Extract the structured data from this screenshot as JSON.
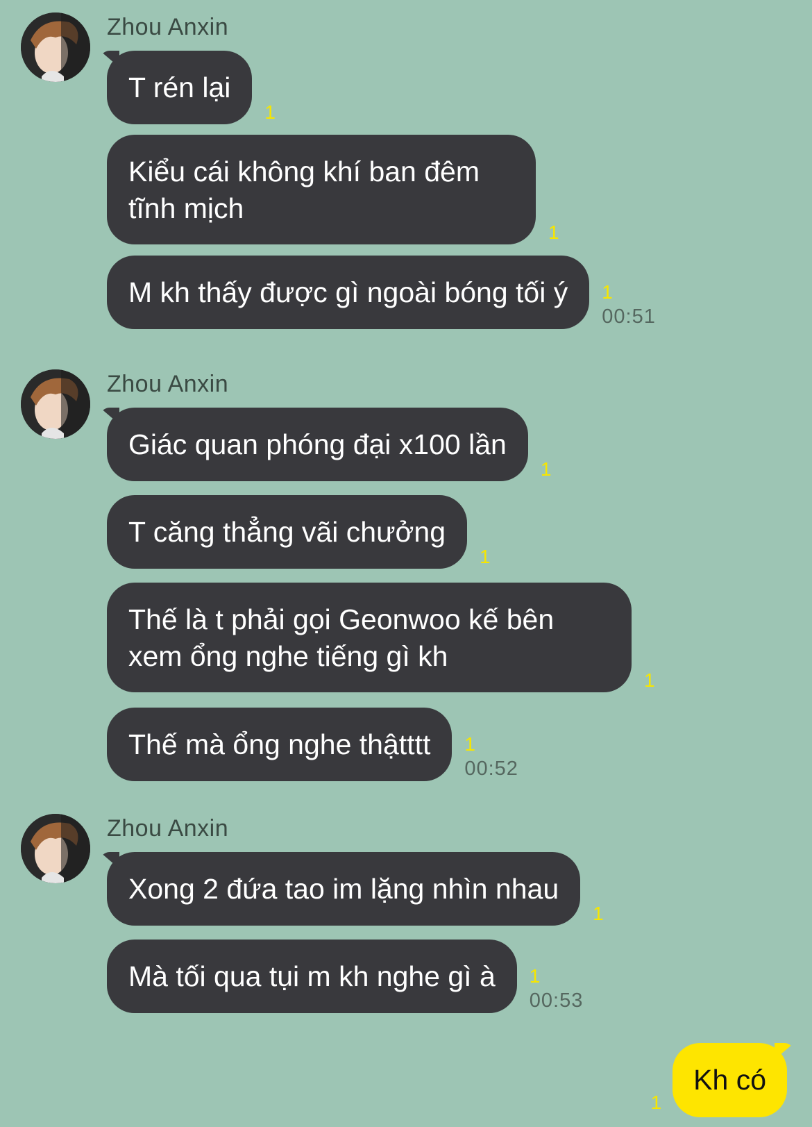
{
  "colors": {
    "background": "#9dc5b4",
    "incoming_bubble": "#39393d",
    "outgoing_bubble": "#fee500",
    "unread": "#f7e600"
  },
  "groups": [
    {
      "sender": "Zhou Anxin",
      "avatar_icon": "profile-photo",
      "messages": [
        {
          "text": "T rén lại",
          "unread": "1",
          "time": ""
        },
        {
          "text": "Kiểu cái không khí ban đêm tĩnh mịch",
          "unread": "1",
          "time": ""
        },
        {
          "text": "M kh thấy được gì ngoài bóng tối ý",
          "unread": "1",
          "time": "00:51"
        }
      ]
    },
    {
      "sender": "Zhou Anxin",
      "avatar_icon": "profile-photo",
      "messages": [
        {
          "text": "Giác quan phóng đại x100 lần",
          "unread": "1",
          "time": ""
        },
        {
          "text": "T căng thẳng vãi chưởng",
          "unread": "1",
          "time": ""
        },
        {
          "text": "Thế là t phải gọi Geonwoo kế bên xem ổng nghe tiếng gì kh",
          "unread": "1",
          "time": ""
        },
        {
          "text": "Thế mà ổng nghe thậtttt",
          "unread": "1",
          "time": "00:52"
        }
      ]
    },
    {
      "sender": "Zhou Anxin",
      "avatar_icon": "profile-photo",
      "messages": [
        {
          "text": "Xong 2 đứa tao im lặng nhìn nhau",
          "unread": "1",
          "time": ""
        },
        {
          "text": "Mà tối qua tụi m kh nghe gì à",
          "unread": "1",
          "time": "00:53"
        }
      ]
    }
  ],
  "outgoing": [
    {
      "text": "Kh có",
      "unread": "1"
    }
  ]
}
